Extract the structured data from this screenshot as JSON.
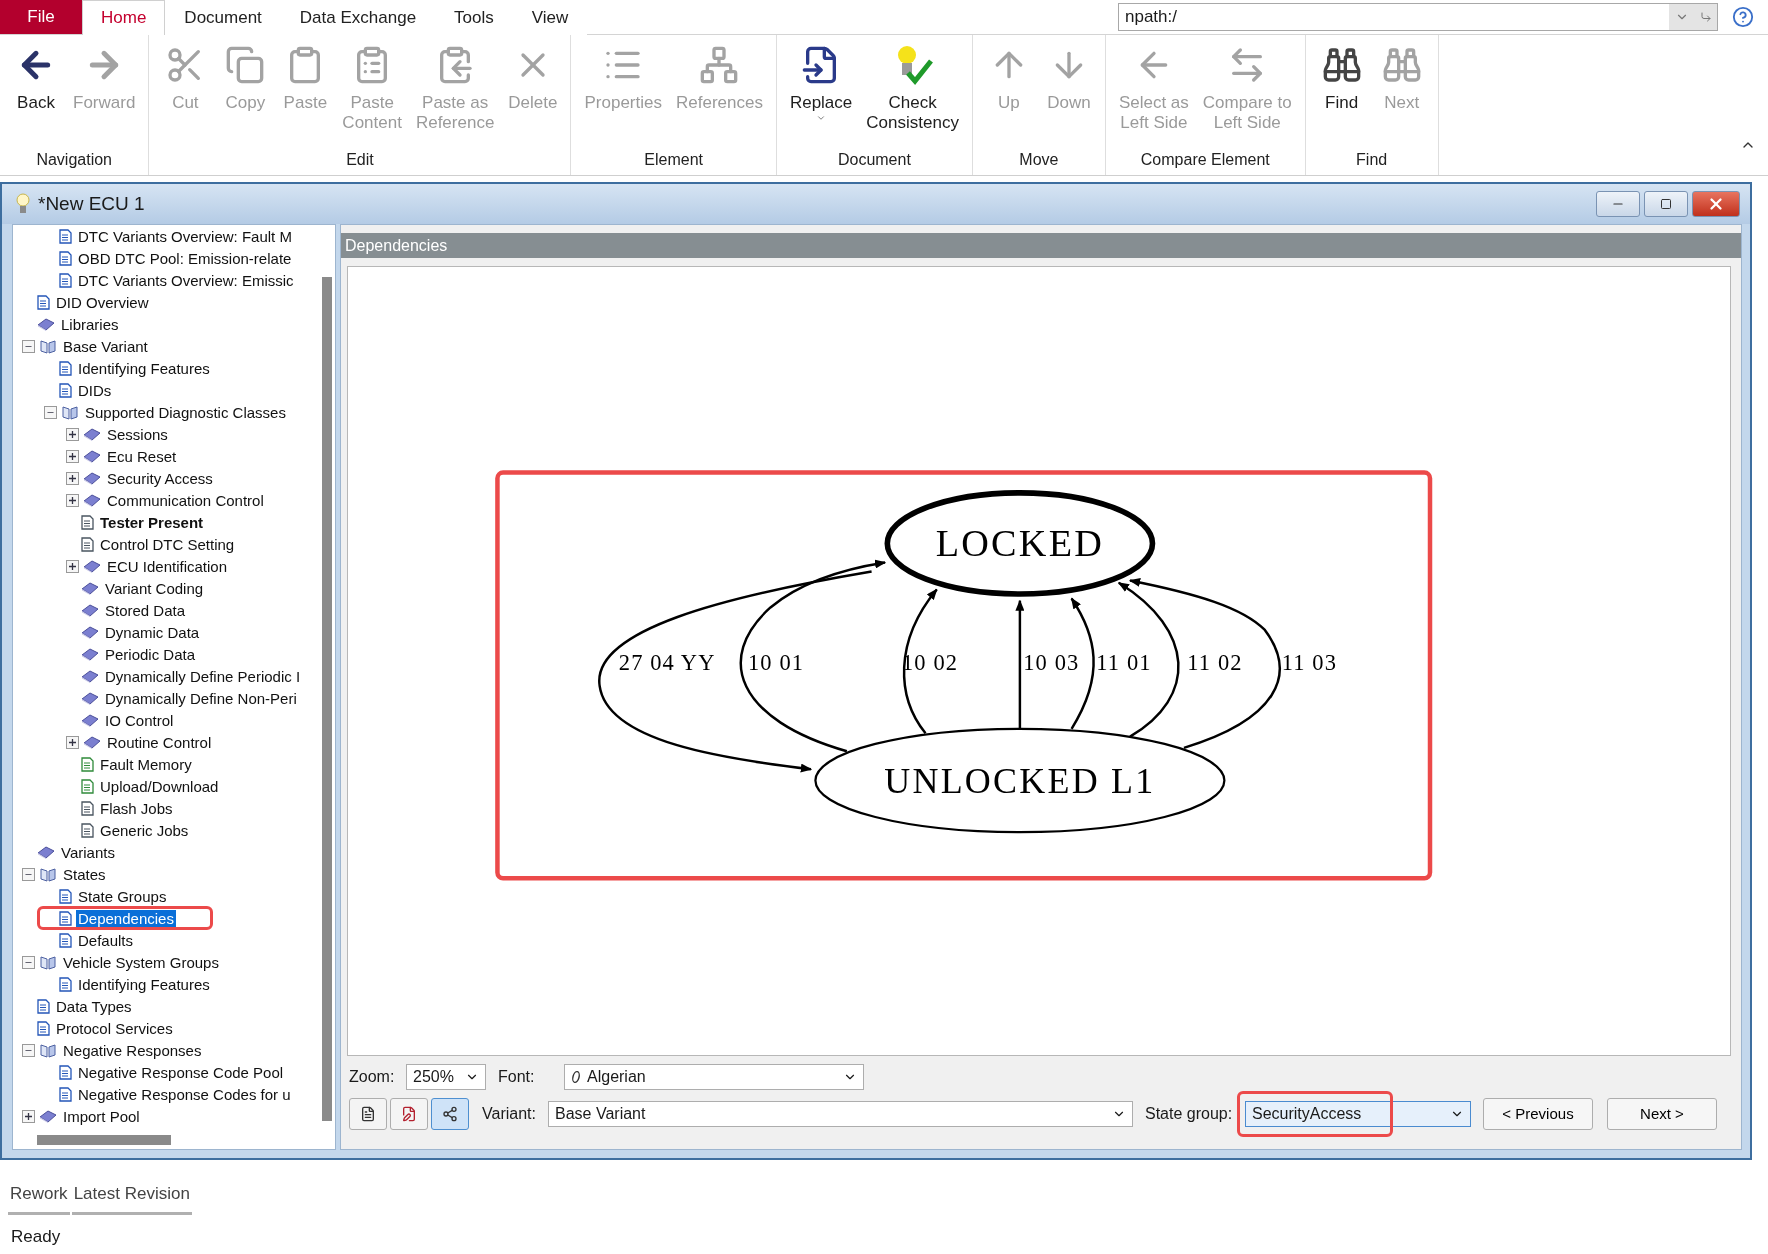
{
  "menu": {
    "file": "File",
    "tabs": [
      {
        "label": "Home",
        "selected": true
      },
      {
        "label": "Document",
        "selected": false
      },
      {
        "label": "Data Exchange",
        "selected": false
      },
      {
        "label": "Tools",
        "selected": false
      },
      {
        "label": "View",
        "selected": false
      }
    ]
  },
  "address_bar": {
    "value": "npath:/"
  },
  "ribbon": {
    "groups": [
      {
        "label": "Navigation",
        "buttons": [
          {
            "label": "Back",
            "disabled": false
          },
          {
            "label": "Forward",
            "disabled": true
          }
        ]
      },
      {
        "label": "Edit",
        "buttons": [
          {
            "label": "Cut",
            "disabled": true
          },
          {
            "label": "Copy",
            "disabled": true
          },
          {
            "label": "Paste",
            "disabled": true
          },
          {
            "label": "Paste\nContent",
            "disabled": true
          },
          {
            "label": "Paste as\nReference",
            "disabled": true
          },
          {
            "label": "Delete",
            "disabled": true
          }
        ]
      },
      {
        "label": "Element",
        "buttons": [
          {
            "label": "Properties",
            "disabled": true
          },
          {
            "label": "References",
            "disabled": true
          }
        ]
      },
      {
        "label": "Document",
        "buttons": [
          {
            "label": "Replace",
            "disabled": false,
            "dropdown": true
          },
          {
            "label": "Check\nConsistency",
            "disabled": false
          }
        ]
      },
      {
        "label": "Move",
        "buttons": [
          {
            "label": "Up",
            "disabled": true
          },
          {
            "label": "Down",
            "disabled": true
          }
        ]
      },
      {
        "label": "Compare Element",
        "buttons": [
          {
            "label": "Select as\nLeft Side",
            "disabled": true
          },
          {
            "label": "Compare to\nLeft Side",
            "disabled": true
          }
        ]
      },
      {
        "label": "Find",
        "buttons": [
          {
            "label": "Find",
            "disabled": false
          },
          {
            "label": "Next",
            "disabled": true
          }
        ]
      }
    ]
  },
  "window": {
    "title": "*New ECU 1"
  },
  "tree": {
    "items": [
      {
        "children": [
          {
            "label": "DTC Variants Overview: Fault M",
            "kind": "page",
            "selected": false
          },
          {
            "label": "OBD DTC Pool: Emission-relate",
            "kind": "page",
            "selected": false
          },
          {
            "label": "DTC Variants Overview: Emissic",
            "kind": "page",
            "selected": false
          }
        ]
      },
      {
        "label": "DID Overview",
        "kind": "page",
        "selected": false
      },
      {
        "label": "Libraries",
        "kind": "book",
        "selected": false
      },
      {
        "label": "Base Variant",
        "kind": "openbook",
        "selected": false,
        "expanded": true,
        "children": [
          {
            "label": "Identifying Features",
            "kind": "page",
            "selected": false
          },
          {
            "label": "DIDs",
            "kind": "page",
            "selected": false
          },
          {
            "label": "Supported Diagnostic Classes",
            "kind": "openbook",
            "selected": false,
            "expanded": true,
            "children": [
              {
                "label": "Sessions",
                "kind": "book",
                "selected": false,
                "expanded": false
              },
              {
                "label": "Ecu Reset",
                "kind": "book",
                "selected": false,
                "expanded": false
              },
              {
                "label": "Security Access",
                "kind": "book",
                "selected": false,
                "expanded": false
              },
              {
                "label": "Communication Control",
                "kind": "book",
                "selected": false,
                "expanded": false
              },
              {
                "label": "Tester Present",
                "kind": "sheet",
                "selected": false,
                "bold": true
              },
              {
                "label": "Control DTC Setting",
                "kind": "sheet",
                "selected": false
              },
              {
                "label": "ECU Identification",
                "kind": "book",
                "selected": false,
                "expanded": false
              },
              {
                "label": "Variant Coding",
                "kind": "book",
                "selected": false
              },
              {
                "label": "Stored Data",
                "kind": "book",
                "selected": false
              },
              {
                "label": "Dynamic Data",
                "kind": "book",
                "selected": false
              },
              {
                "label": "Periodic Data",
                "kind": "book",
                "selected": false
              },
              {
                "label": "Dynamically Define Periodic I",
                "kind": "book",
                "selected": false
              },
              {
                "label": "Dynamically Define Non-Peri",
                "kind": "book",
                "selected": false
              },
              {
                "label": "IO Control",
                "kind": "book",
                "selected": false
              },
              {
                "label": "Routine Control",
                "kind": "book",
                "selected": false,
                "expanded": false
              },
              {
                "label": "Fault Memory",
                "kind": "script",
                "selected": false
              },
              {
                "label": "Upload/Download",
                "kind": "script",
                "selected": false
              },
              {
                "label": "Flash Jobs",
                "kind": "job",
                "selected": false
              },
              {
                "label": "Generic Jobs",
                "kind": "job",
                "selected": false
              }
            ]
          }
        ]
      },
      {
        "label": "Variants",
        "kind": "book",
        "selected": false
      },
      {
        "label": "States",
        "kind": "openbook",
        "selected": false,
        "expanded": true,
        "children": [
          {
            "label": "State Groups",
            "kind": "page",
            "selected": false
          },
          {
            "label": "Dependencies",
            "kind": "page",
            "selected": true,
            "highlighted": true
          },
          {
            "label": "Defaults",
            "kind": "page",
            "selected": false
          }
        ]
      },
      {
        "label": "Vehicle System Groups",
        "kind": "openbook",
        "selected": false,
        "expanded": true,
        "children": [
          {
            "label": "Identifying Features",
            "kind": "page",
            "selected": false
          }
        ]
      },
      {
        "label": "Data Types",
        "kind": "page",
        "selected": false
      },
      {
        "label": "Protocol Services",
        "kind": "page",
        "selected": false
      },
      {
        "label": "Negative Responses",
        "kind": "openbook",
        "selected": false,
        "expanded": true,
        "children": [
          {
            "label": "Negative Response Code Pool",
            "kind": "page",
            "selected": false
          },
          {
            "label": "Negative Response Codes for u",
            "kind": "page",
            "selected": false
          }
        ]
      },
      {
        "label": "Import Pool",
        "kind": "book",
        "selected": false,
        "expanded": false
      }
    ]
  },
  "panel": {
    "title": "Dependencies"
  },
  "graph": {
    "highlighted": true,
    "nodes": [
      {
        "label": "LOCKED",
        "current": true
      },
      {
        "label": "UNLOCKED L1",
        "current": false
      }
    ],
    "edges": [
      {
        "label": "27 04 YY"
      },
      {
        "label": "10 01"
      },
      {
        "label": "10 02"
      },
      {
        "label": "10 03"
      },
      {
        "label": "11 01"
      },
      {
        "label": "11 02"
      },
      {
        "label": "11 03"
      }
    ]
  },
  "controls": {
    "zoom": {
      "label": "Zoom:",
      "value": "250%"
    },
    "font": {
      "label": "Font:",
      "value": "Algerian"
    },
    "view_buttons": [
      {
        "selected": false
      },
      {
        "selected": false
      },
      {
        "selected": true
      }
    ],
    "variant": {
      "label": "Variant:",
      "value": "Base Variant"
    },
    "state_group": {
      "label": "State group:",
      "value": "SecurityAccess",
      "highlighted": true
    },
    "buttons": [
      "< Previous",
      "Next >"
    ]
  },
  "bottom_tabs": [
    {
      "label": "Rework"
    },
    {
      "label": "Latest Revision"
    }
  ],
  "status_bar": "Ready"
}
